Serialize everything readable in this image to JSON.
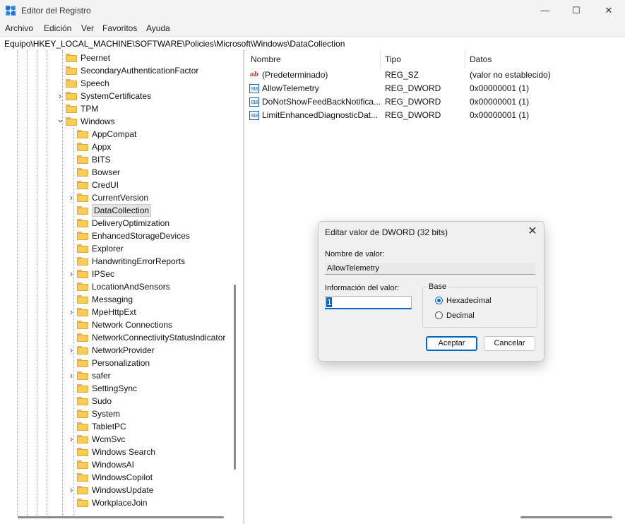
{
  "window": {
    "title": "Editor del Registro",
    "controls": {
      "minimize": "—",
      "maximize": "☐",
      "close": "✕"
    }
  },
  "menu": [
    "Archivo",
    "Edición",
    "Ver",
    "Favoritos",
    "Ayuda"
  ],
  "address": "Equipo\\HKEY_LOCAL_MACHINE\\SOFTWARE\\Policies\\Microsoft\\Windows\\DataCollection",
  "tree": [
    {
      "label": "Peernet",
      "level": 0,
      "expander": "none"
    },
    {
      "label": "SecondaryAuthenticationFactor",
      "level": 0,
      "expander": "none"
    },
    {
      "label": "Speech",
      "level": 0,
      "expander": "none"
    },
    {
      "label": "SystemCertificates",
      "level": 0,
      "expander": "collapsed"
    },
    {
      "label": "TPM",
      "level": 0,
      "expander": "none"
    },
    {
      "label": "Windows",
      "level": 0,
      "expander": "expanded"
    },
    {
      "label": "AppCompat",
      "level": 1,
      "expander": "none"
    },
    {
      "label": "Appx",
      "level": 1,
      "expander": "none"
    },
    {
      "label": "BITS",
      "level": 1,
      "expander": "none"
    },
    {
      "label": "Bowser",
      "level": 1,
      "expander": "none"
    },
    {
      "label": "CredUI",
      "level": 1,
      "expander": "none"
    },
    {
      "label": "CurrentVersion",
      "level": 1,
      "expander": "collapsed"
    },
    {
      "label": "DataCollection",
      "level": 1,
      "expander": "none",
      "selected": true
    },
    {
      "label": "DeliveryOptimization",
      "level": 1,
      "expander": "none"
    },
    {
      "label": "EnhancedStorageDevices",
      "level": 1,
      "expander": "none"
    },
    {
      "label": "Explorer",
      "level": 1,
      "expander": "none"
    },
    {
      "label": "HandwritingErrorReports",
      "level": 1,
      "expander": "none"
    },
    {
      "label": "IPSec",
      "level": 1,
      "expander": "collapsed"
    },
    {
      "label": "LocationAndSensors",
      "level": 1,
      "expander": "none"
    },
    {
      "label": "Messaging",
      "level": 1,
      "expander": "none"
    },
    {
      "label": "MpeHttpExt",
      "level": 1,
      "expander": "collapsed"
    },
    {
      "label": "Network Connections",
      "level": 1,
      "expander": "none"
    },
    {
      "label": "NetworkConnectivityStatusIndicator",
      "level": 1,
      "expander": "none"
    },
    {
      "label": "NetworkProvider",
      "level": 1,
      "expander": "collapsed"
    },
    {
      "label": "Personalization",
      "level": 1,
      "expander": "none"
    },
    {
      "label": "safer",
      "level": 1,
      "expander": "collapsed"
    },
    {
      "label": "SettingSync",
      "level": 1,
      "expander": "none"
    },
    {
      "label": "Sudo",
      "level": 1,
      "expander": "none"
    },
    {
      "label": "System",
      "level": 1,
      "expander": "none"
    },
    {
      "label": "TabletPC",
      "level": 1,
      "expander": "none"
    },
    {
      "label": "WcmSvc",
      "level": 1,
      "expander": "collapsed"
    },
    {
      "label": "Windows Search",
      "level": 1,
      "expander": "none"
    },
    {
      "label": "WindowsAI",
      "level": 1,
      "expander": "none"
    },
    {
      "label": "WindowsCopilot",
      "level": 1,
      "expander": "none"
    },
    {
      "label": "WindowsUpdate",
      "level": 1,
      "expander": "collapsed"
    },
    {
      "label": "WorkplaceJoin",
      "level": 1,
      "expander": "none"
    }
  ],
  "list": {
    "columns": {
      "name": "Nombre",
      "type": "Tipo",
      "data": "Datos"
    },
    "rows": [
      {
        "icon": "string-value-icon",
        "glyph": "ab",
        "name": "(Predeterminado)",
        "type": "REG_SZ",
        "data": "(valor no establecido)"
      },
      {
        "icon": "dword-value-icon",
        "glyph": "010",
        "name": "AllowTelemetry",
        "type": "REG_DWORD",
        "data": "0x00000001 (1)"
      },
      {
        "icon": "dword-value-icon",
        "glyph": "010",
        "name": "DoNotShowFeedBackNotifica...",
        "type": "REG_DWORD",
        "data": "0x00000001 (1)"
      },
      {
        "icon": "dword-value-icon",
        "glyph": "010",
        "name": "LimitEnhancedDiagnosticDat...",
        "type": "REG_DWORD",
        "data": "0x00000001 (1)"
      }
    ]
  },
  "dialog": {
    "title": "Editar valor de DWORD (32 bits)",
    "close": "✕",
    "value_name_label": "Nombre de valor:",
    "value_name": "AllowTelemetry",
    "value_data_label": "Información del valor:",
    "value_data": "1",
    "base_label": "Base",
    "base_options": {
      "hex": "Hexadecimal",
      "dec": "Decimal"
    },
    "base_selected": "hex",
    "ok": "Aceptar",
    "cancel": "Cancelar"
  }
}
